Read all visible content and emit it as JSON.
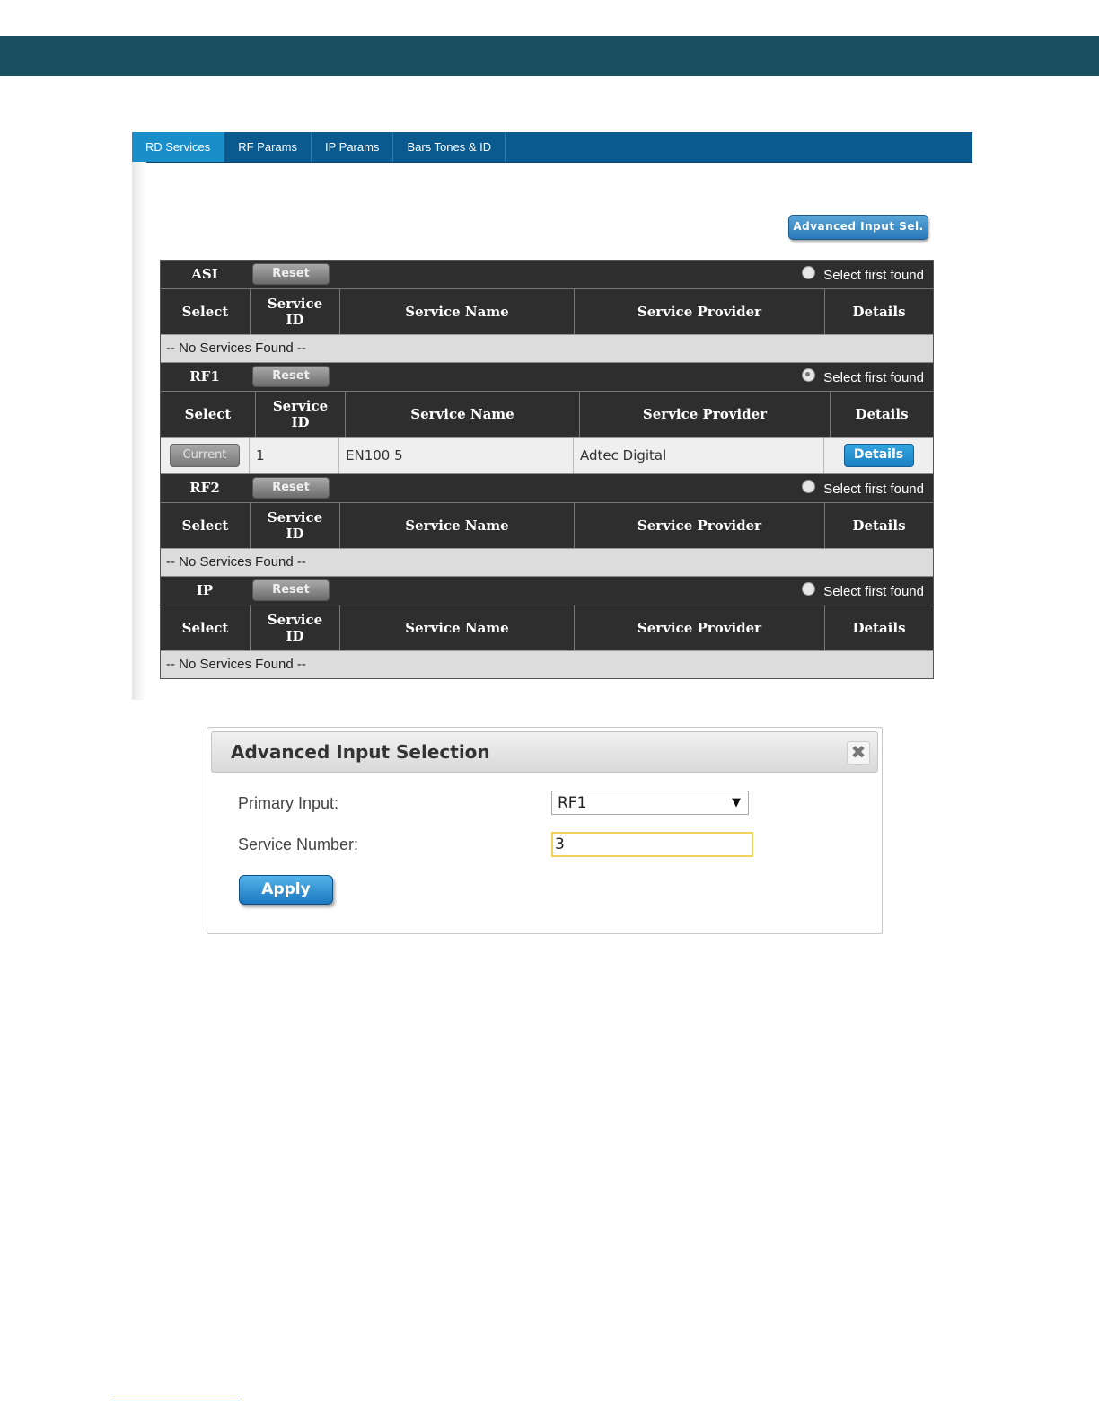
{
  "tabs": [
    {
      "label": "RD Services",
      "active": true
    },
    {
      "label": "RF Params",
      "active": false
    },
    {
      "label": "IP Params",
      "active": false
    },
    {
      "label": "Bars Tones & ID",
      "active": false
    }
  ],
  "advanced_button_label": "Advanced Input Sel.",
  "columns": {
    "select": "Select",
    "service_id_line1": "Service",
    "service_id_line2": "ID",
    "service_name": "Service Name",
    "service_provider": "Service Provider",
    "details": "Details"
  },
  "reset_label": "Reset",
  "select_first_found_label": "Select first found",
  "sections": {
    "asi": {
      "name": "ASI",
      "empty_text": "-- No Services Found --"
    },
    "rf1": {
      "name": "RF1",
      "row": {
        "select_label": "Current",
        "service_id": "1",
        "service_name": "EN100 5",
        "service_provider": "Adtec Digital",
        "details_label": "Details"
      }
    },
    "rf2": {
      "name": "RF2",
      "empty_text": "-- No Services Found --"
    },
    "ip": {
      "name": "IP",
      "empty_text": "-- No Services Found --"
    }
  },
  "dialog": {
    "title": "Advanced Input Selection",
    "close_icon": "close-icon",
    "primary_input_label": "Primary Input:",
    "primary_input_value": "RF1",
    "service_number_label": "Service Number:",
    "service_number_value": "3",
    "apply_label": "Apply"
  }
}
